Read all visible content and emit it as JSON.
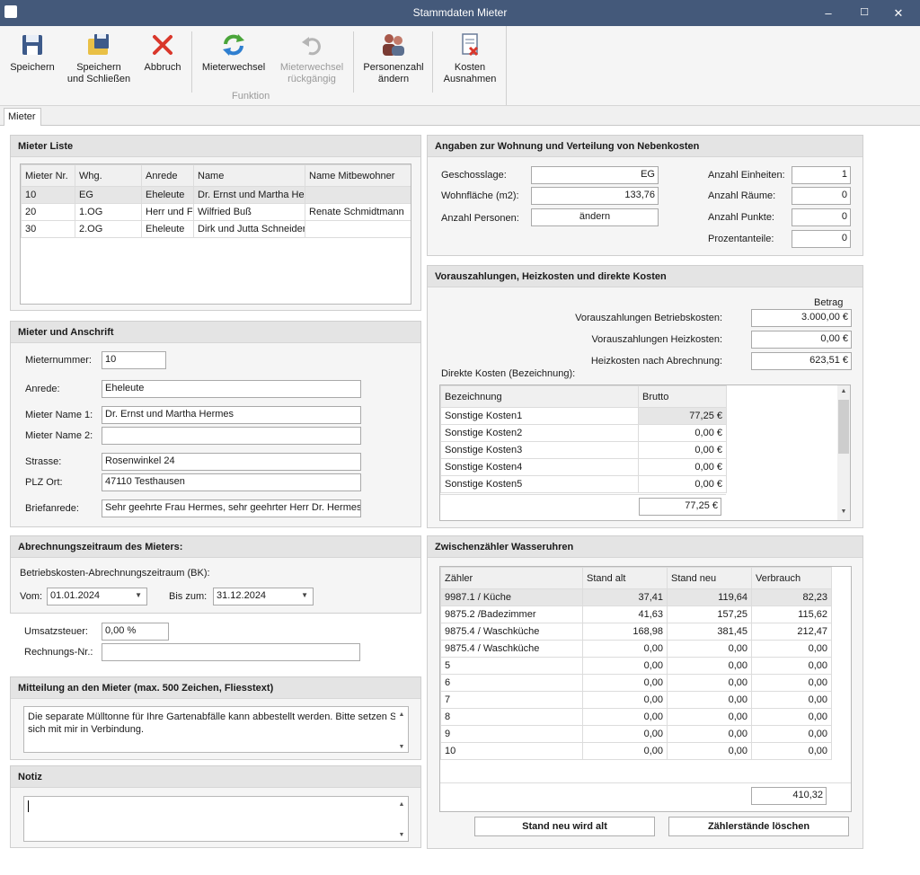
{
  "window": {
    "title": "Stammdaten Mieter",
    "minimize": "–",
    "maximize": "☐",
    "close": "✕"
  },
  "ribbon": {
    "save": "Speichern",
    "save_close_1": "Speichern",
    "save_close_2": "und Schließen",
    "cancel": "Abbruch",
    "change_tenant": "Mieterwechsel",
    "undo_change_1": "Mieterwechsel",
    "undo_change_2": "rückgängig",
    "persons_1": "Personenzahl",
    "persons_2": "ändern",
    "costs_1": "Kosten",
    "costs_2": "Ausnahmen",
    "group_label": "Funktion"
  },
  "tabs": {
    "mieter": "Mieter"
  },
  "mieter_liste": {
    "title": "Mieter Liste",
    "columns": [
      "Mieter Nr.",
      "Whg.",
      "Anrede",
      "Name",
      "Name Mitbewohner"
    ],
    "rows": [
      [
        "10",
        "EG",
        "Eheleute",
        "Dr. Ernst und Martha He",
        ""
      ],
      [
        "20",
        "1.OG",
        "Herr und F",
        "Wilfried Buß",
        "Renate Schmidtmann"
      ],
      [
        "30",
        "2.OG",
        "Eheleute",
        "Dirk und Jutta Schneider",
        ""
      ]
    ]
  },
  "anschrift": {
    "title": "Mieter und Anschrift",
    "mieternummer_label": "Mieternummer:",
    "mieternummer": "10",
    "anrede_label": "Anrede:",
    "anrede": "Eheleute",
    "name1_label": "Mieter Name 1:",
    "name1": "Dr. Ernst und Martha Hermes",
    "name2_label": "Mieter Name 2:",
    "name2": "",
    "strasse_label": "Strasse:",
    "strasse": "Rosenwinkel 24",
    "plz_label": "PLZ Ort:",
    "plz": "47110 Testhausen",
    "brief_label": "Briefanrede:",
    "brief": "Sehr geehrte Frau Hermes, sehr geehrter Herr Dr. Hermes,"
  },
  "zeitraum": {
    "title": "Abrechnungszeitraum des Mieters:",
    "bk_label": "Betriebskosten-Abrechnungszeitraum (BK):",
    "vom_label": "Vom:",
    "vom": "01.01.2024",
    "bis_label": "Bis zum:",
    "bis": "31.12.2024"
  },
  "steuer": {
    "ust_label": "Umsatzsteuer:",
    "ust": "0,00 %",
    "rech_label": "Rechnungs-Nr.:",
    "rech": ""
  },
  "mitteilung": {
    "title": "Mitteilung an den Mieter (max. 500 Zeichen, Fliesstext)",
    "text": "Die separate Mülltonne für Ihre Gartenabfälle kann abbestellt werden. Bitte setzen Sie sich mit mir in Verbindung."
  },
  "notiz": {
    "title": "Notiz",
    "text": ""
  },
  "wohnung": {
    "title": "Angaben zur Wohnung und Verteilung von Nebenkosten",
    "geschoss_label": "Geschosslage:",
    "geschoss": "EG",
    "flaeche_label": "Wohnfläche (m2):",
    "flaeche": "133,76",
    "personen_label": "Anzahl Personen:",
    "personen_btn": "ändern",
    "einheiten_label": "Anzahl Einheiten:",
    "einheiten": "1",
    "raeume_label": "Anzahl Räume:",
    "raeume": "0",
    "punkte_label": "Anzahl Punkte:",
    "punkte": "0",
    "prozent_label": "Prozentanteile:",
    "prozent": "0"
  },
  "vorauszahlungen": {
    "title": "Vorauszahlungen, Heizkosten und direkte Kosten",
    "betrag_label": "Betrag",
    "bk_label": "Vorauszahlungen Betriebskosten:",
    "bk": "3.000,00 €",
    "hk_label": "Vorauszahlungen Heizkosten:",
    "hk": "0,00 €",
    "hka_label": "Heizkosten nach Abrechnung:",
    "hka": "623,51 €",
    "direkt_label": "Direkte Kosten (Bezeichnung):",
    "columns": [
      "Bezeichnung",
      "Brutto"
    ],
    "rows": [
      [
        "Sonstige Kosten1",
        "77,25 €"
      ],
      [
        "Sonstige Kosten2",
        "0,00 €"
      ],
      [
        "Sonstige Kosten3",
        "0,00 €"
      ],
      [
        "Sonstige Kosten4",
        "0,00 €"
      ],
      [
        "Sonstige Kosten5",
        "0,00 €"
      ]
    ],
    "summe": "77,25 €"
  },
  "wasser": {
    "title": "Zwischenzähler Wasseruhren",
    "columns": [
      "Zähler",
      "Stand alt",
      "Stand neu",
      "Verbrauch"
    ],
    "rows": [
      [
        "9987.1 / Küche",
        "37,41",
        "119,64",
        "82,23"
      ],
      [
        "9875.2 /Badezimmer",
        "41,63",
        "157,25",
        "115,62"
      ],
      [
        "9875.4 / Waschküche",
        "168,98",
        "381,45",
        "212,47"
      ],
      [
        "9875.4 / Waschküche",
        "0,00",
        "0,00",
        "0,00"
      ],
      [
        "5",
        "0,00",
        "0,00",
        "0,00"
      ],
      [
        "6",
        "0,00",
        "0,00",
        "0,00"
      ],
      [
        "7",
        "0,00",
        "0,00",
        "0,00"
      ],
      [
        "8",
        "0,00",
        "0,00",
        "0,00"
      ],
      [
        "9",
        "0,00",
        "0,00",
        "0,00"
      ],
      [
        "10",
        "0,00",
        "0,00",
        "0,00"
      ]
    ],
    "summe": "410,32",
    "btn_alt": "Stand neu wird alt",
    "btn_loeschen": "Zählerstände löschen"
  }
}
